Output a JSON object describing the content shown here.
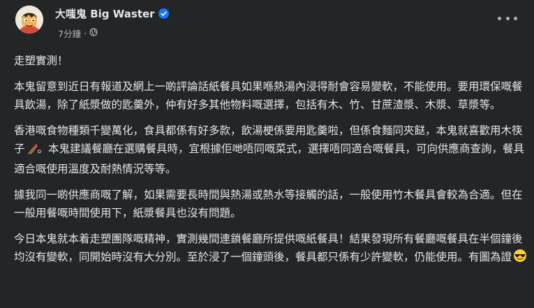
{
  "post": {
    "author_name": "大嗤鬼 Big Waster",
    "timestamp": "7分鐘",
    "paragraphs": [
      "走塑實測！",
      "本鬼留意到近日有報道及網上一啲評論話紙餐具如果喺熱湯內浸得耐會容易變軟，不能使用。要用環保嘅餐具飲湯，除了紙漿做的匙羹外，仲有好多其他物料嘅選擇，包括有木、竹、甘蔗渣漿、木漿、草漿等。",
      "香港嘅食物種類千變萬化，食具都係有好多款，飲湯梗係要用匙羹啦，但係食麵同夾餸，本鬼就喜歡用木筷子",
      "。本鬼建議餐廳在選購餐具時，宜根據佢哋唔同嘅菜式，選擇唔同適合嘅餐具，可向供應商查詢，餐具適合嘅使用溫度及耐熱情況等等。",
      "據我同一啲供應商嘅了解，如果需要長時間與熱湯或熱水等接觸的話，一般使用竹木餐具會較為合適。但在一般用餐嘅時間使用下，紙漿餐具也沒有問題。",
      "今日本鬼就本着走塑團隊嘅精神，實測幾間連鎖餐廳所提供嘅紙餐具！結果發現所有餐廳嘅餐具在半個鐘後均沒有變軟，同開始時沒有大分別。至於浸了一個鐘頭後，餐具都只係有少許變軟，仍能使用。有圖為證"
    ],
    "icons": {
      "avatar": "cartoon-avatar",
      "verified": "verified-badge-icon",
      "privacy": "globe-icon",
      "more": "more-options-icon",
      "chopsticks": "chopsticks-emoji",
      "sunglasses": "sunglasses-emoji"
    },
    "colors": {
      "background": "#242526",
      "text": "#e4e6eb",
      "secondary_text": "#b0b3b8",
      "verified_blue": "#1877f2"
    }
  }
}
